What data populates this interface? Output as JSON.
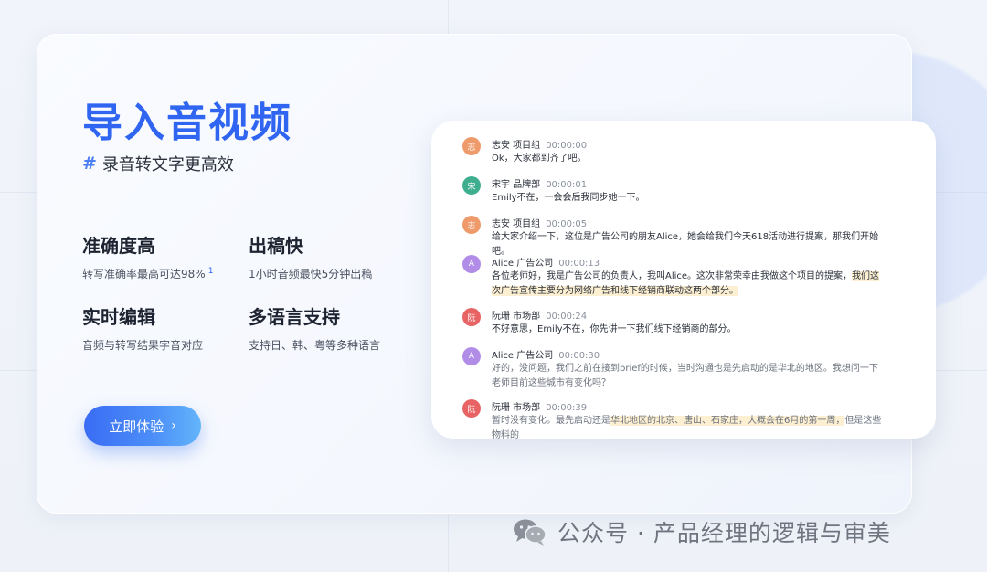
{
  "hero": {
    "title": "导入音视频",
    "subtitle_hash": "#",
    "subtitle": "录音转文字更高效"
  },
  "features": [
    {
      "title": "准确度高",
      "desc": "转写准确率最高可达98%",
      "footnote": "1"
    },
    {
      "title": "出稿快",
      "desc": "1小时音频最快5分钟出稿"
    },
    {
      "title": "实时编辑",
      "desc": "音频与转写结果字音对应"
    },
    {
      "title": "多语言支持",
      "desc": "支持日、韩、粤等多种语言"
    }
  ],
  "cta": {
    "label": "立即体验",
    "chevron": "›"
  },
  "transcript": [
    {
      "avatar": "志",
      "avatar_color": "#ee9a6a",
      "speaker": "志安 项目组",
      "time": "00:00:00",
      "text_before": "Ok，大家都到齐了吧。",
      "highlight": "",
      "text_after": ""
    },
    {
      "avatar": "宋",
      "avatar_color": "#3fae8e",
      "speaker": "宋宇 品牌部",
      "time": "00:00:01",
      "text_before": "Emily不在，一会会后我同步她一下。",
      "highlight": "",
      "text_after": ""
    },
    {
      "avatar": "志",
      "avatar_color": "#ee9a6a",
      "speaker": "志安 项目组",
      "time": "00:00:05",
      "text_before": "给大家介绍一下，这位是广告公司的朋友Alice，她会给我们今天618活动进行提案，那我们开始吧。",
      "highlight": "",
      "text_after": ""
    },
    {
      "avatar": "A",
      "avatar_color": "#b18de8",
      "speaker": "Alice 广告公司",
      "time": "00:00:13",
      "text_before": "各位老师好，我是广告公司的负责人，我叫Alice。这次非常荣幸由我做这个项目的提案，",
      "highlight": "我们这次广告宣传主要分为网络广告和线下经销商联动这两个部分。",
      "text_after": ""
    },
    {
      "avatar": "阮",
      "avatar_color": "#e86464",
      "speaker": "阮珊 市场部",
      "time": "00:00:24",
      "text_before": "不好意思，Emily不在，你先讲一下我们线下经销商的部分。",
      "highlight": "",
      "text_after": ""
    },
    {
      "avatar": "A",
      "avatar_color": "#b18de8",
      "speaker": "Alice 广告公司",
      "time": "00:00:30",
      "text_before": "好的，没问题，我们之前在接到brief的时候，当时沟通也是先启动的是华北的地区。我想问一下老师目前这些城市有变化吗？",
      "highlight": "",
      "text_after": "",
      "faded": true
    },
    {
      "avatar": "阮",
      "avatar_color": "#e86464",
      "speaker": "阮珊 市场部",
      "time": "00:00:39",
      "text_before": "暂时没有变化。最先启动还是",
      "highlight": "华北地区的北京、唐山、石家庄，大概会在6月的第一周，",
      "text_after": "但是这些物料的",
      "faded": true
    }
  ],
  "watermark": {
    "text": "公众号 · 产品经理的逻辑与审美",
    "icon": "wechat-icon"
  }
}
